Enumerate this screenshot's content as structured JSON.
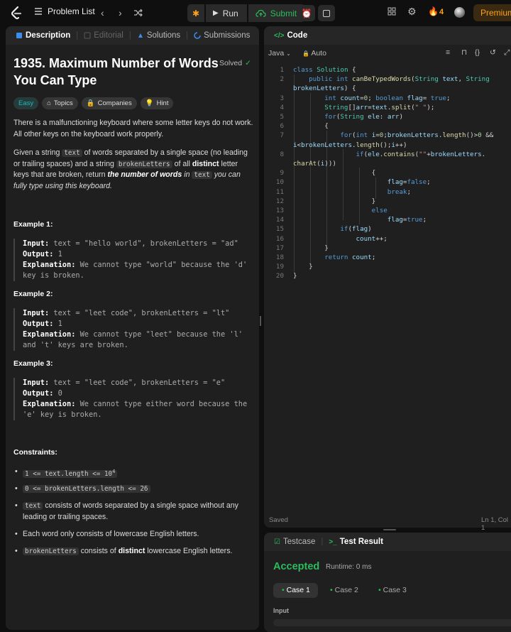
{
  "nav": {
    "problem_list": "Problem List",
    "run": "Run",
    "submit": "Submit",
    "streak": "4",
    "premium": "Premium"
  },
  "left_tabs": [
    {
      "label": "Description",
      "active": true,
      "icon": "description-icon"
    },
    {
      "label": "Editorial",
      "active": false,
      "icon": "editorial-icon"
    },
    {
      "label": "Solutions",
      "active": false,
      "icon": "solutions-icon"
    },
    {
      "label": "Submissions",
      "active": false,
      "icon": "submissions-icon"
    }
  ],
  "problem": {
    "title": "1935. Maximum Number of Words You Can Type",
    "status": "Solved",
    "difficulty": "Easy",
    "tags": [
      "Topics",
      "Companies",
      "Hint"
    ],
    "p1": "There is a malfunctioning keyboard where some letter keys do not work. All other keys on the keyboard work properly.",
    "p2_a": "Given a string ",
    "p2_code1": "text",
    "p2_b": " of words separated by a single space (no leading or trailing spaces) and a string ",
    "p2_code2": "brokenLetters",
    "p2_c": " of all ",
    "p2_bold": "distinct",
    "p2_d": " letter keys that are broken, return ",
    "p2_em": "the number of words",
    "p2_e": " in ",
    "p2_code3": "text",
    "p2_f": " you can fully type using this keyboard.",
    "examples": [
      {
        "head": "Example 1:",
        "input": "text = \"hello world\", brokenLetters = \"ad\"",
        "output": "1",
        "explanation": "We cannot type \"world\" because the 'd' key is broken."
      },
      {
        "head": "Example 2:",
        "input": "text = \"leet code\", brokenLetters = \"lt\"",
        "output": "1",
        "explanation": "We cannot type \"leet\" because the 'l' and 't' keys are broken."
      },
      {
        "head": "Example 3:",
        "input": "text = \"leet code\", brokenLetters = \"e\"",
        "output": "0",
        "explanation": "We cannot type either word because the 'e' key is broken."
      }
    ],
    "labels": {
      "input": "Input:",
      "output": "Output:",
      "explanation": "Explanation:"
    },
    "constraints_head": "Constraints:",
    "c1": "1 <= text.length <= 10",
    "c1_sup": "4",
    "c2": "0 <= brokenLetters.length <= 26",
    "c3_code": "text",
    "c3_text": " consists of words separated by a single space without any leading or trailing spaces.",
    "c4": "Each word only consists of lowercase English letters.",
    "c5_code": "brokenLetters",
    "c5_a": " consists of ",
    "c5_bold": "distinct",
    "c5_b": " lowercase English letters."
  },
  "editor": {
    "tab": "Code",
    "language": "Java",
    "mode": "Auto",
    "status": "Saved",
    "cursor": "Ln 1, Col 1",
    "lines": [
      "1",
      "2",
      "",
      "3",
      "4",
      "5",
      "6",
      "7",
      "",
      "8",
      "",
      "9",
      "10",
      "11",
      "12",
      "13",
      "14",
      "15",
      "16",
      "17",
      "18",
      "19",
      "20"
    ]
  },
  "result": {
    "tab_testcase": "Testcase",
    "tab_result": "Test Result",
    "verdict": "Accepted",
    "runtime": "Runtime: 0 ms",
    "cases": [
      "Case 1",
      "Case 2",
      "Case 3"
    ],
    "input_label": "Input"
  },
  "colors": {
    "accepted": "#2cbb5d",
    "easy": "#1cbaba",
    "premium": "#ffa116",
    "bg": "#1f1f1f"
  }
}
